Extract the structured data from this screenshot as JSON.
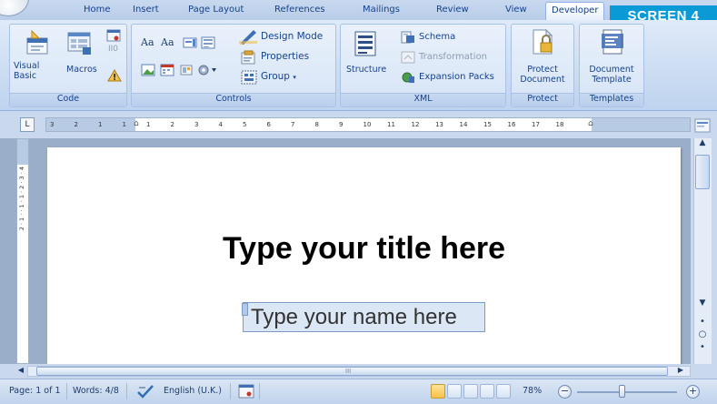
{
  "ribbon_tabs": [
    "Home",
    "Insert",
    "Page Layout",
    "References",
    "Mailings",
    "Review",
    "View",
    "Developer"
  ],
  "active_tab": "Developer",
  "screen_badge": "SCREEN 4",
  "groups": {
    "code": {
      "label": "Code",
      "visual_basic": "Visual Basic",
      "macros": "Macros"
    },
    "controls": {
      "label": "Controls",
      "design_mode": "Design Mode",
      "properties": "Properties",
      "group": "Group",
      "rich_text_glyph": "Aa",
      "plain_text_glyph": "Aa"
    },
    "xml": {
      "label": "XML",
      "structure": "Structure",
      "schema": "Schema",
      "transformation": "Transformation",
      "expansion_packs": "Expansion Packs"
    },
    "protect": {
      "label": "Protect",
      "protect_document": "Protect Document"
    },
    "templates": {
      "label": "Templates",
      "document_template": "Document Template"
    }
  },
  "ruler": {
    "tab_selector": "L",
    "marks": [
      "3",
      "2",
      "1",
      "1",
      "1",
      "2",
      "3",
      "4",
      "5",
      "6",
      "7",
      "8",
      "9",
      "10",
      "11",
      "12",
      "13",
      "14",
      "15",
      "16",
      "17",
      "18"
    ],
    "vertical_text": "2 · 1 · · 1 · 1 · 2 · 3 · 4"
  },
  "document": {
    "title": "Type your title here",
    "name_placeholder": "Type your name here"
  },
  "status_bar": {
    "page": "Page: 1 of 1",
    "words": "Words: 4/8",
    "language": "English (U.K.)",
    "zoom": "78%",
    "zoom_level": 0.78
  },
  "colors": {
    "badge": "#0a9bd7",
    "ribbon_text": "#15428b",
    "active_view": "#f6c24a"
  },
  "icons": [
    "office-orb-icon",
    "visual-basic-icon",
    "macros-icon",
    "record-macro-icon",
    "pause-macro-icon",
    "macro-security-icon",
    "design-mode-icon",
    "properties-icon",
    "group-icon",
    "structure-icon",
    "schema-icon",
    "transformation-icon",
    "expansion-packs-icon",
    "protect-document-icon",
    "document-template-icon",
    "spelling-check-icon",
    "macro-record-status-icon",
    "zoom-out-icon",
    "zoom-in-icon"
  ]
}
